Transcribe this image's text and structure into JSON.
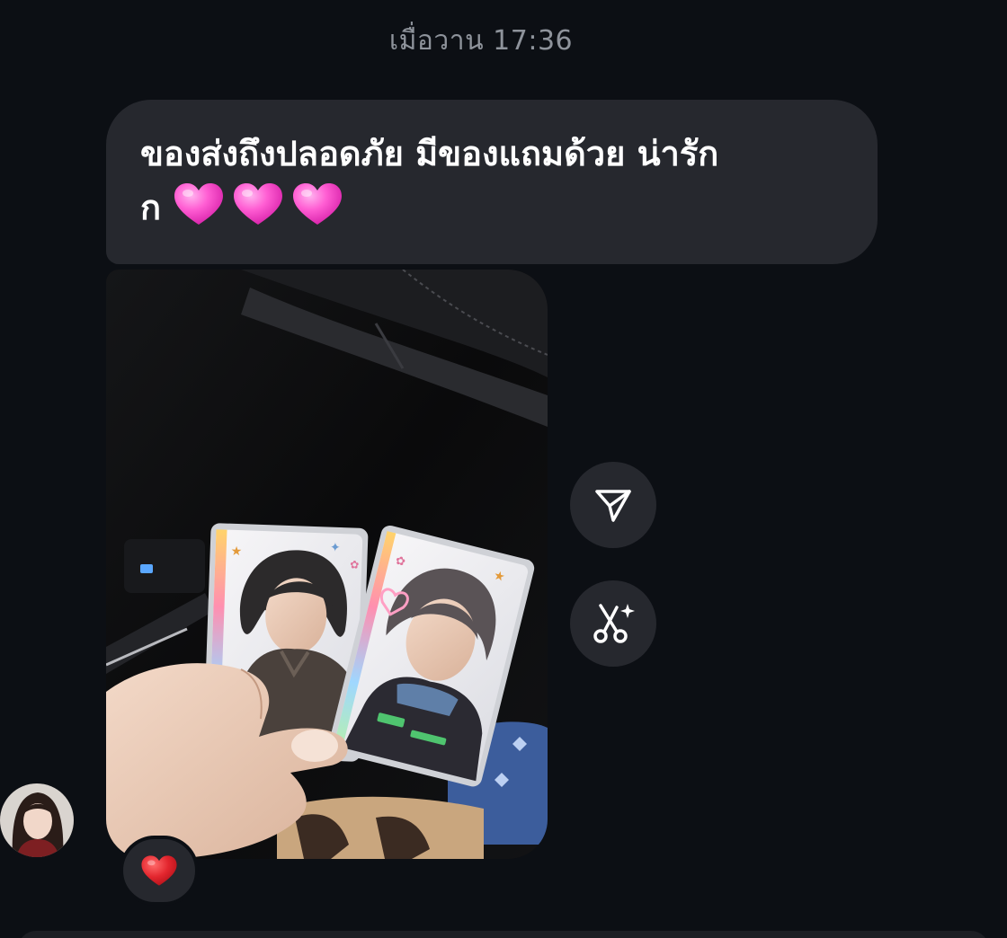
{
  "thread": {
    "timestamp": "เมื่อวาน 17:36"
  },
  "message": {
    "text_line1": "ของส่งถึงปลอดภัย มีของแถมด้วย น่ารัก",
    "text_line2_prefix": "ก",
    "emoji": [
      "pink-heart",
      "pink-heart",
      "pink-heart"
    ],
    "photo": {
      "description_icon": "photocards-image"
    },
    "reaction": "red-heart"
  },
  "actions": {
    "share_icon": "send-paper-plane-icon",
    "cutout_icon": "scissors-sparkle-icon"
  },
  "colors": {
    "background": "#0c0f14",
    "bubble": "#26282e",
    "timestamp": "#8e939b",
    "pink_heart": "#ff5ed3",
    "red_heart": "#e3262e"
  }
}
